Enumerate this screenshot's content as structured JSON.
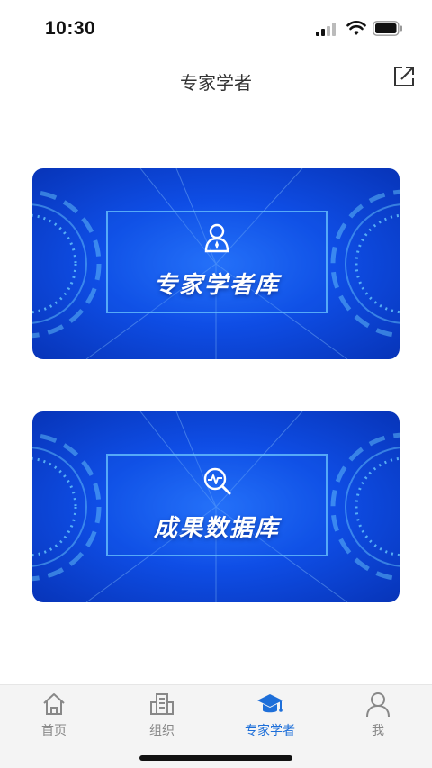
{
  "status_bar": {
    "time": "10:30",
    "signal_icon": "cellular-signal-icon",
    "wifi_icon": "wifi-icon",
    "battery_icon": "battery-icon"
  },
  "nav": {
    "title": "专家学者",
    "share_icon": "share-external-icon"
  },
  "cards": [
    {
      "title": "专家学者库",
      "icon": "expert-person-icon"
    },
    {
      "title": "成果数据库",
      "icon": "search-analytics-icon"
    }
  ],
  "tabs": [
    {
      "label": "首页",
      "icon": "home-icon",
      "active": false
    },
    {
      "label": "组织",
      "icon": "building-icon",
      "active": false
    },
    {
      "label": "专家学者",
      "icon": "graduation-cap-icon",
      "active": true
    },
    {
      "label": "我",
      "icon": "user-icon",
      "active": false
    }
  ],
  "colors": {
    "accent": "#1e6fd9",
    "card_blue": "#0f4ee6",
    "inactive": "#888888"
  }
}
